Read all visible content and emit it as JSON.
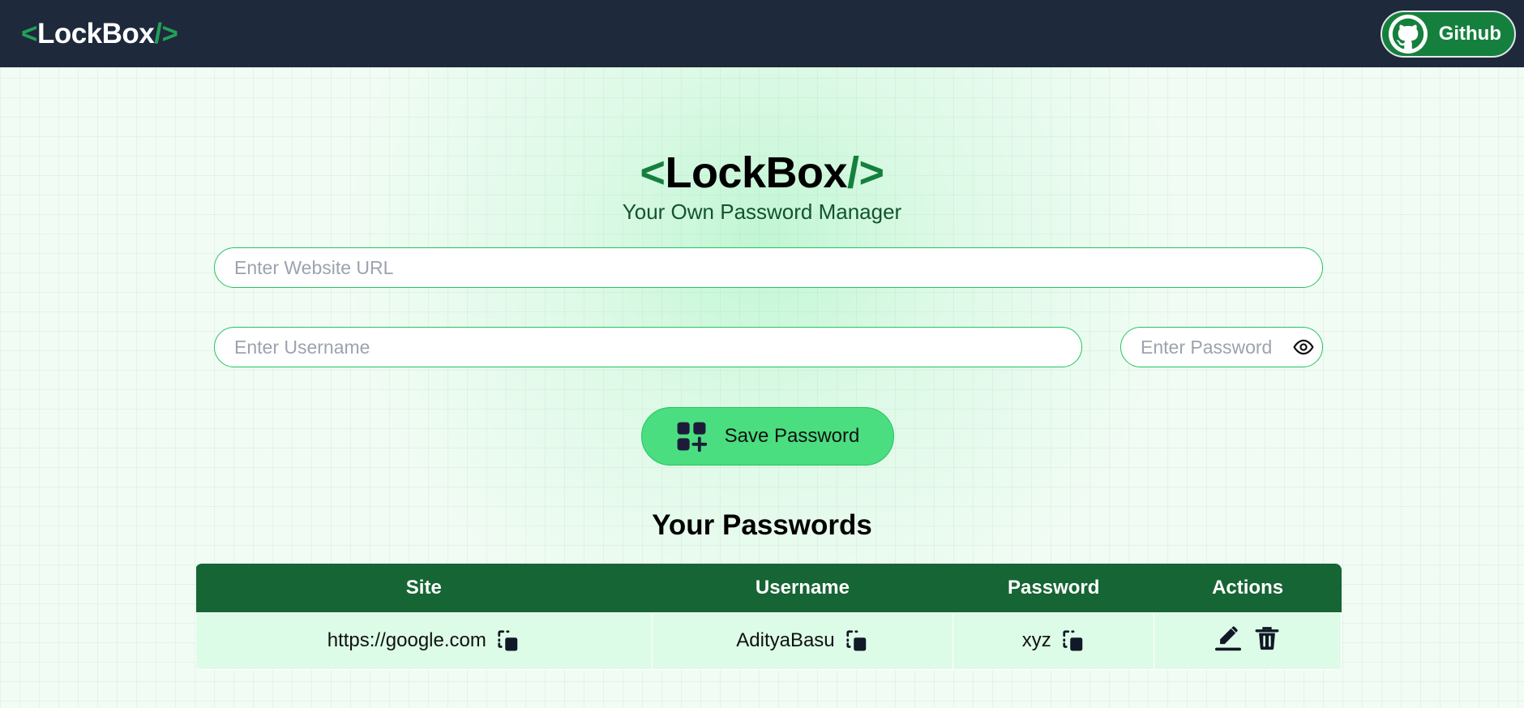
{
  "navbar": {
    "brand_open": "<",
    "brand_name": "LockBox",
    "brand_slash": "/",
    "brand_close": ">",
    "github_label": "Github"
  },
  "hero": {
    "title_open": "<",
    "title_name": "LockBox",
    "title_slash": "/",
    "title_close": ">",
    "subtitle": "Your Own Password Manager"
  },
  "form": {
    "site_placeholder": "Enter Website URL",
    "username_placeholder": "Enter Username",
    "password_placeholder": "Enter Password",
    "save_label": "Save Password"
  },
  "passwords": {
    "title": "Your Passwords",
    "columns": [
      "Site",
      "Username",
      "Password",
      "Actions"
    ],
    "rows": [
      {
        "site": "https://google.com",
        "username": "AdityaBasu",
        "password": "xyz"
      }
    ]
  },
  "colors": {
    "navbar_bg": "#1e293b",
    "accent_green": "#15803d",
    "button_green": "#4ade80",
    "table_header": "#166534",
    "table_row": "#dcfce7"
  },
  "icons": {
    "github": "github-icon",
    "eye": "eye-icon",
    "save": "add-grid-icon",
    "copy": "copy-icon",
    "edit": "edit-icon",
    "delete": "trash-icon"
  }
}
